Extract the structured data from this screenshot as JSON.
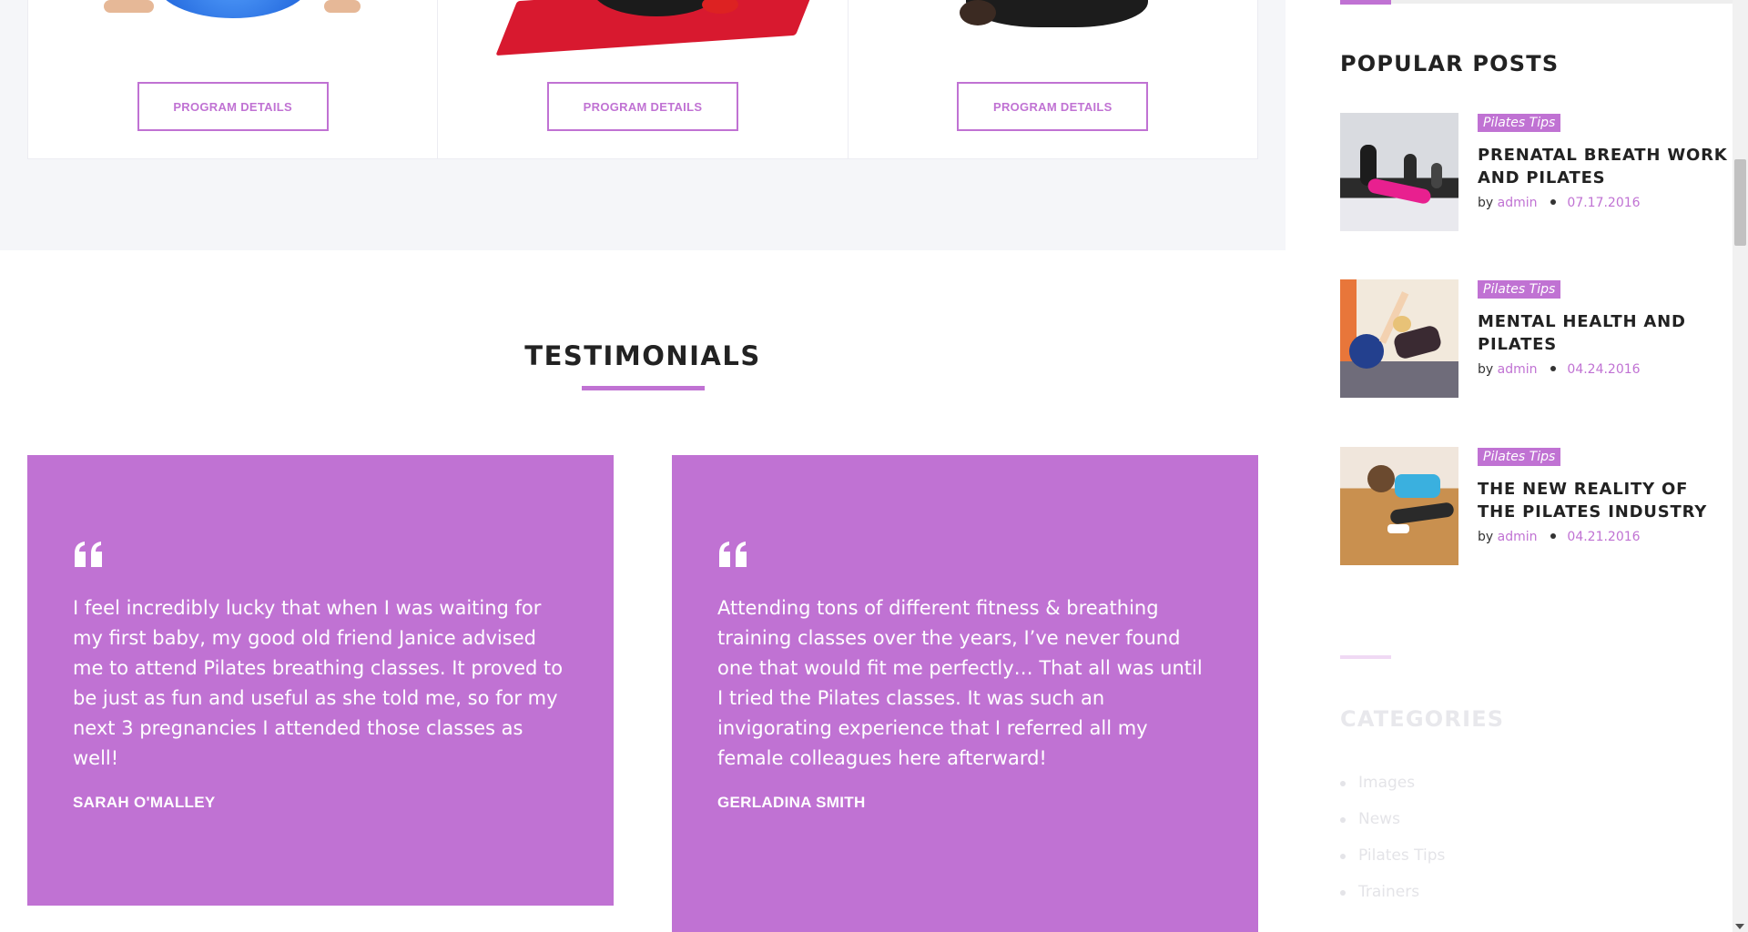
{
  "programs": [
    {
      "button_label": "PROGRAM DETAILS"
    },
    {
      "button_label": "PROGRAM DETAILS"
    },
    {
      "button_label": "PROGRAM DETAILS"
    }
  ],
  "testimonials": {
    "title": "TESTIMONIALS",
    "items": [
      {
        "text": "I feel incredibly lucky that when I was waiting for my first baby, my good old friend Janice advised me to attend Pilates breathing classes. It proved to be just as fun and useful as she told me, so for my next 3 pregnancies I attended those classes as well!",
        "author": "SARAH O'MALLEY"
      },
      {
        "text": "Attending tons of different fitness & breathing training classes over the years, I’ve never found one that would fit me perfectly… That all was until I tried the Pilates classes. It was such an invigorating experience that I referred all my female colleagues here afterward!",
        "author": "GERLADINA SMITH"
      }
    ]
  },
  "sidebar": {
    "popular_title": "POPULAR POSTS",
    "posts": [
      {
        "category": "Pilates Tips",
        "title": "PRENATAL BREATH WORK AND PILATES",
        "by": "by",
        "author": "admin",
        "date": "07.17.2016"
      },
      {
        "category": "Pilates Tips",
        "title": "MENTAL HEALTH AND PILATES",
        "by": "by",
        "author": "admin",
        "date": "04.24.2016"
      },
      {
        "category": "Pilates Tips",
        "title": "THE NEW REALITY OF THE PILATES INDUSTRY",
        "by": "by",
        "author": "admin",
        "date": "04.21.2016"
      }
    ],
    "categories_title": "CATEGORIES",
    "categories": [
      "Images",
      "News",
      "Pilates Tips",
      "Trainers"
    ]
  },
  "colors": {
    "accent": "#c072d3",
    "band_background": "#f5f6f9",
    "text_dark": "#222222"
  },
  "icons": {
    "quote": "quote-icon"
  }
}
